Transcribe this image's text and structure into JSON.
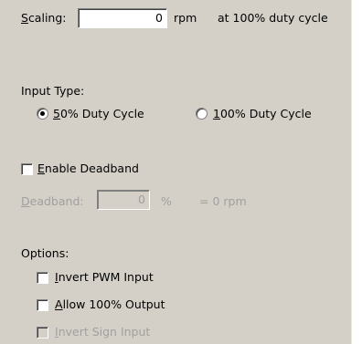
{
  "scaling": {
    "label_mnemonic": "S",
    "label_rest": "caling:",
    "value": "0",
    "unit": "rpm",
    "note": "at 100% duty cycle"
  },
  "input_type": {
    "heading": "Input Type:",
    "options": [
      {
        "mnemonic": "5",
        "rest": "0% Duty Cycle",
        "selected": true
      },
      {
        "mnemonic": "1",
        "rest": "00% Duty Cycle",
        "selected": false
      }
    ]
  },
  "deadband": {
    "enable_mnemonic": "E",
    "enable_rest": "nable Deadband",
    "enable_checked": false,
    "label_mnemonic": "D",
    "label_rest": "eadband:",
    "value": "0",
    "unit": "%",
    "equivalent": "= 0 rpm"
  },
  "options": {
    "heading": "Options:",
    "items": [
      {
        "mnemonic": "I",
        "rest": "nvert PWM Input",
        "checked": false,
        "enabled": true
      },
      {
        "mnemonic": "A",
        "rest": "llow 100% Output",
        "checked": false,
        "enabled": true
      },
      {
        "mnemonic": "I",
        "rest": "nvert Sign Input",
        "checked": false,
        "enabled": false
      }
    ]
  }
}
